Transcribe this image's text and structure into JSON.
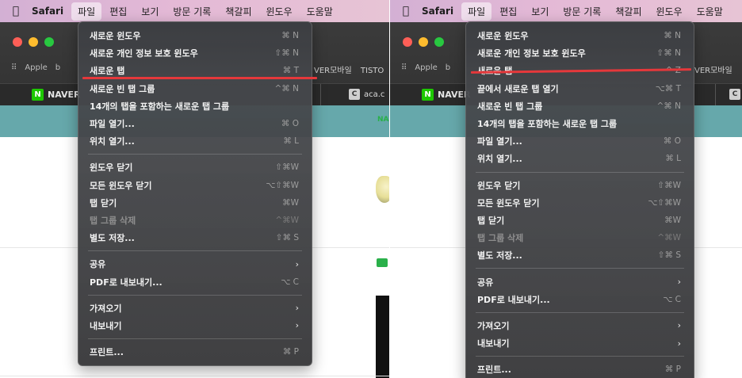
{
  "menubar": {
    "app": "Safari",
    "menus": [
      "파일",
      "편집",
      "보기",
      "방문 기록",
      "책갈피",
      "윈도우",
      "도움말"
    ],
    "active": "파일"
  },
  "browser": {
    "favorites": [
      "Apple"
    ],
    "favorites_clip_left": "b",
    "favorites_right_left": "VER모바일",
    "favorites_right_left_extra": "TISTO",
    "favorites_right_right": "VER모바일",
    "tab_naver": "NAVER",
    "tab_aca_left": "aca.c",
    "teal_text_left": "NA"
  },
  "left_menu": {
    "items": [
      {
        "label": "새로운 윈도우",
        "shortcut": "⌘ N"
      },
      {
        "label": "새로운 개인 정보 보호 윈도우",
        "shortcut": "⇧⌘ N"
      },
      {
        "label": "새로운 탭",
        "shortcut": "⌘ T"
      },
      {
        "label": "새로운 빈 탭 그룹",
        "shortcut": "^⌘ N"
      },
      {
        "label": "14개의 탭을 포함하는 새로운 탭 그룹",
        "shortcut": ""
      },
      {
        "label": "파일 열기...",
        "shortcut": "⌘ O"
      },
      {
        "label": "위치 열기...",
        "shortcut": "⌘ L"
      },
      {
        "sep": true
      },
      {
        "label": "윈도우 닫기",
        "shortcut": "⇧⌘W"
      },
      {
        "label": "모든 윈도우 닫기",
        "shortcut": "⌥⇧⌘W"
      },
      {
        "label": "탭 닫기",
        "shortcut": "⌘W"
      },
      {
        "label": "탭 그룹 삭제",
        "shortcut": "^⌘W",
        "disabled": true
      },
      {
        "label": "별도 저장...",
        "shortcut": "⇧⌘ S"
      },
      {
        "sep": true
      },
      {
        "label": "공유",
        "submenu": true
      },
      {
        "label": "PDF로 내보내기...",
        "shortcut": "⌥ C"
      },
      {
        "sep": true
      },
      {
        "label": "가져오기",
        "submenu": true
      },
      {
        "label": "내보내기",
        "submenu": true
      },
      {
        "sep": true
      },
      {
        "label": "프린트...",
        "shortcut": "⌘ P"
      }
    ]
  },
  "right_menu": {
    "items": [
      {
        "label": "새로운 윈도우",
        "shortcut": "⌘ N"
      },
      {
        "label": "새로운 개인 정보 보호 윈도우",
        "shortcut": "⇧⌘ N"
      },
      {
        "label": "새로운 탭",
        "shortcut": "^ Z"
      },
      {
        "label": "끝에서 새로운 탭 열기",
        "shortcut": "⌥⌘ T"
      },
      {
        "label": "새로운 빈 탭 그룹",
        "shortcut": "^⌘ N"
      },
      {
        "label": "14개의 탭을 포함하는 새로운 탭 그룹",
        "shortcut": ""
      },
      {
        "label": "파일 열기...",
        "shortcut": "⌘ O"
      },
      {
        "label": "위치 열기...",
        "shortcut": "⌘ L"
      },
      {
        "sep": true
      },
      {
        "label": "윈도우 닫기",
        "shortcut": "⇧⌘W"
      },
      {
        "label": "모든 윈도우 닫기",
        "shortcut": "⌥⇧⌘W"
      },
      {
        "label": "탭 닫기",
        "shortcut": "⌘W"
      },
      {
        "label": "탭 그룹 삭제",
        "shortcut": "^⌘W",
        "disabled": true
      },
      {
        "label": "별도 저장...",
        "shortcut": "⇧⌘ S"
      },
      {
        "sep": true
      },
      {
        "label": "공유",
        "submenu": true
      },
      {
        "label": "PDF로 내보내기...",
        "shortcut": "⌥ C"
      },
      {
        "sep": true
      },
      {
        "label": "가져오기",
        "submenu": true
      },
      {
        "label": "내보내기",
        "submenu": true
      },
      {
        "sep": true
      },
      {
        "label": "프린트...",
        "shortcut": "⌘ P"
      }
    ]
  },
  "icons": {
    "apple": "apple-logo-icon",
    "grid": "grid-icon",
    "submenu": "chevron-right-icon"
  },
  "colors": {
    "highlight_underline": "#e5383b",
    "menubar": "#e4b9d6",
    "teal_banner": "#66a8ab"
  }
}
